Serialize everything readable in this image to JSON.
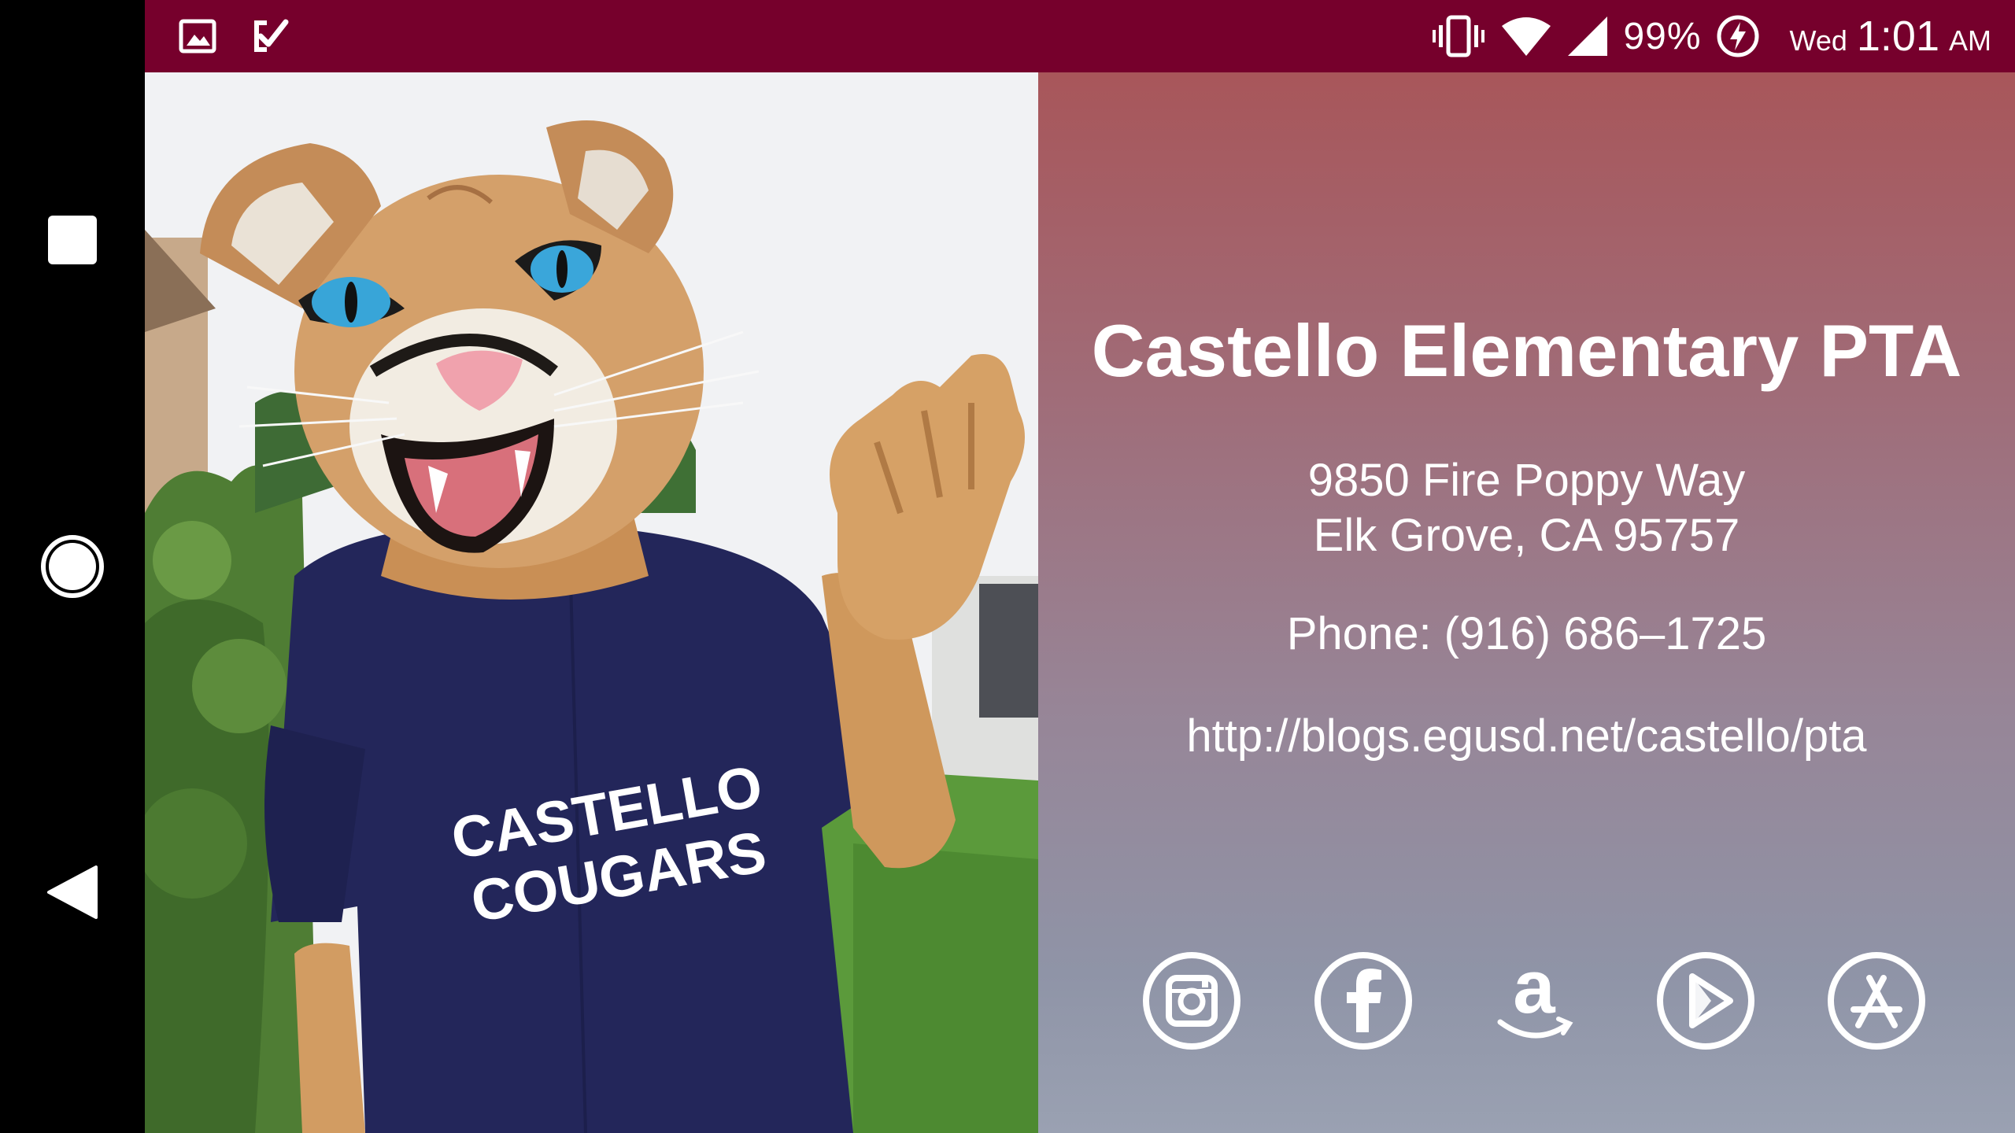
{
  "status_bar": {
    "battery_percent": "99%",
    "day": "Wed",
    "time": "1:01",
    "ampm": "AM",
    "color": "#76002c",
    "left_icons": [
      "gallery-icon",
      "task-check-icon"
    ],
    "right_icons": [
      "vibrate-icon",
      "wifi-icon",
      "signal-icon",
      "battery-charging-icon"
    ]
  },
  "navigation": {
    "recents": "square-icon",
    "home": "circle-icon",
    "back": "triangle-back-icon"
  },
  "mascot_photo": {
    "shirt_line1": "CASTELLO",
    "shirt_line2": "COUGARS"
  },
  "organization": {
    "name": "Castello Elementary PTA",
    "address_line1": "9850 Fire Poppy Way",
    "address_line2": "Elk Grove, CA 95757",
    "phone": "Phone: (916) 686–1725",
    "website": "http://blogs.egusd.net/castello/pta"
  },
  "social_links": [
    {
      "icon": "instagram-icon"
    },
    {
      "icon": "facebook-icon"
    },
    {
      "icon": "amazon-icon"
    },
    {
      "icon": "google-play-icon"
    },
    {
      "icon": "app-store-icon"
    }
  ]
}
